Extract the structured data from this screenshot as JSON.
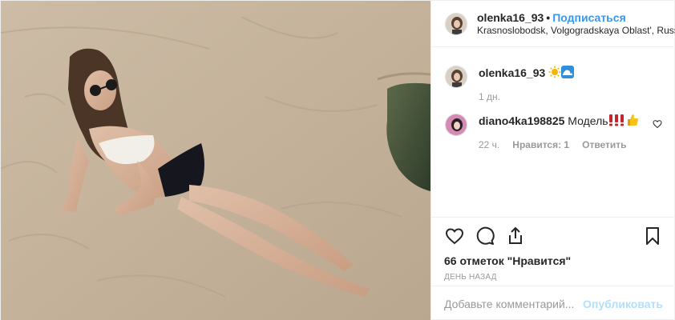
{
  "post": {
    "username": "olenka16_93",
    "separator": "•",
    "follow_label": "Подписаться",
    "location": "Krasnoslobodsk, Volgogradskaya Oblast', Russia"
  },
  "caption": {
    "username": "olenka16_93",
    "emojis": [
      "sun-emoji",
      "wave-emoji"
    ],
    "time": "1 дн."
  },
  "comment": {
    "username": "diano4ka198825",
    "text": "Модель",
    "emojis": [
      "exclamation-marks-emoji",
      "thumbs-up-emoji"
    ],
    "time": "22 ч.",
    "likes_label": "Нравится: 1",
    "reply_label": "Ответить"
  },
  "actions": {
    "like_icon": "heart-icon",
    "comment_icon": "comment-icon",
    "share_icon": "share-icon",
    "save_icon": "bookmark-icon"
  },
  "likes_text": "66 отметок \"Нравится\"",
  "posted_ago": "ДЕНЬ НАЗАД",
  "add_comment": {
    "placeholder": "Добавьте комментарий...",
    "publish_label": "Опубликовать"
  },
  "colors": {
    "accent": "#3897f0",
    "publish_disabled": "#b2dffc",
    "secondary_text": "#999999",
    "border": "#efefef"
  }
}
